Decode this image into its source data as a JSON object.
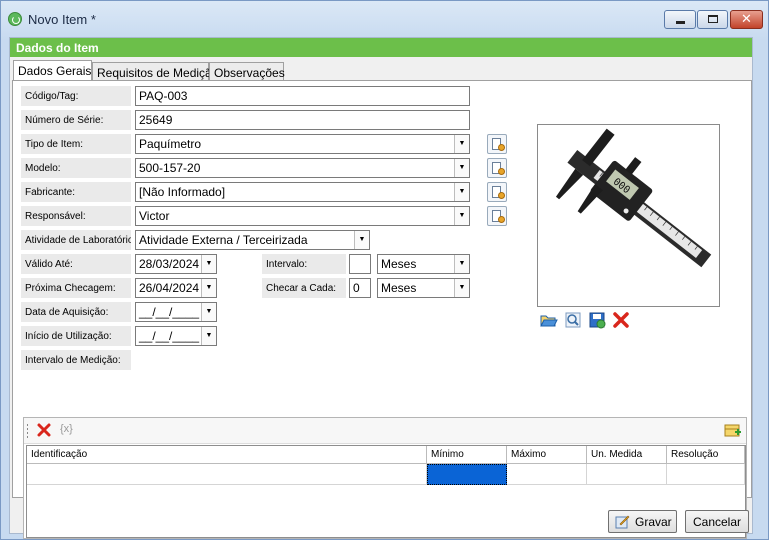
{
  "window": {
    "title": "Novo Item *"
  },
  "section_header": "Dados do Item",
  "tabs": [
    "Dados Gerais",
    "Requisitos de Medição",
    "Observações"
  ],
  "form": {
    "codigo": {
      "label": "Código/Tag:",
      "value": "PAQ-003"
    },
    "serie": {
      "label": "Número de Série:",
      "value": "25649"
    },
    "tipo": {
      "label": "Tipo de Item:",
      "value": "Paquímetro"
    },
    "modelo": {
      "label": "Modelo:",
      "value": "500-157-20"
    },
    "fabricante": {
      "label": "Fabricante:",
      "value": "[Não Informado]"
    },
    "responsavel": {
      "label": "Responsável:",
      "value": "Victor"
    },
    "atividade": {
      "label": "Atividade de Laboratório:",
      "value": "Atividade Externa / Terceirizada"
    },
    "valido": {
      "label": "Válido Até:",
      "value": "28/03/2024"
    },
    "intervalo": {
      "label": "Intervalo:",
      "value": "",
      "unit": "Meses"
    },
    "proxima": {
      "label": "Próxima Checagem:",
      "value": "26/04/2024"
    },
    "checar": {
      "label": "Checar a Cada:",
      "value": "0",
      "unit": "Meses"
    },
    "aquisicao": {
      "label": "Data de Aquisição:",
      "value": "__/__/____"
    },
    "inicio": {
      "label": "Início de Utilização:",
      "value": "__/__/____"
    },
    "intervalo_medicao": {
      "label": "Intervalo de Medição:"
    }
  },
  "image": {
    "display_text": "000"
  },
  "grid": {
    "columns": [
      "Identificação",
      "Mínimo",
      "Máximo",
      "Un. Medida",
      "Resolução"
    ]
  },
  "buttons": {
    "save": "Gravar",
    "cancel": "Cancelar"
  },
  "icons": {
    "app": "app-icon",
    "open": "folder-open-icon",
    "preview": "magnify-icon",
    "save_image": "save-icon",
    "delete_image": "delete-icon",
    "grid_delete": "delete-icon",
    "grid_formula": "formula-icon",
    "grid_add": "add-row-icon"
  },
  "colors": {
    "header_green": "#6cbf4a",
    "selection_blue": "#0a64d6"
  }
}
